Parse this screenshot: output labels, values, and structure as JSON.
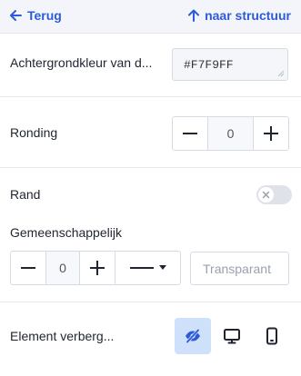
{
  "topbar": {
    "back_label": "Terug",
    "structure_label": "naar structuur"
  },
  "background": {
    "label": "Achtergrondkleur van d...",
    "value": "#F7F9FF"
  },
  "rounding": {
    "label": "Ronding",
    "value": "0"
  },
  "border": {
    "label": "Rand",
    "toggle_on": false,
    "common_label": "Gemeenschappelijk",
    "width_value": "0",
    "transparency_placeholder": "Transparant"
  },
  "visibility": {
    "label": "Element verberg...",
    "options": [
      {
        "icon": "eye-off-icon",
        "active": true
      },
      {
        "icon": "desktop-icon",
        "active": false
      },
      {
        "icon": "mobile-icon",
        "active": false
      }
    ]
  },
  "colors": {
    "accent": "#2D5BD8",
    "active_bg": "#CFE0FB"
  }
}
